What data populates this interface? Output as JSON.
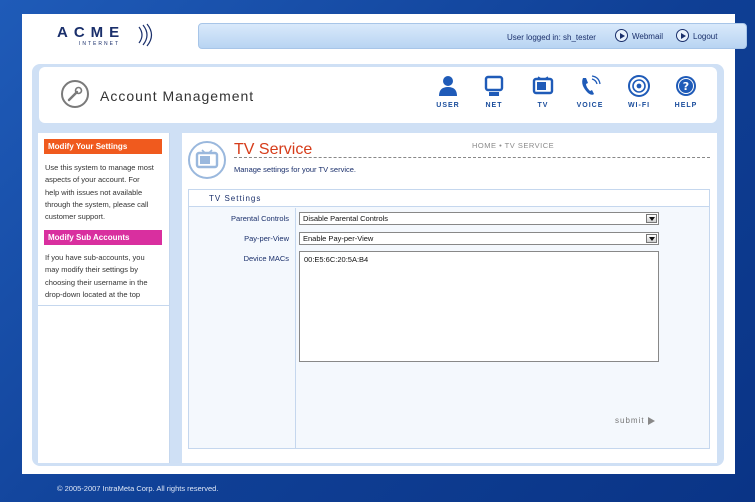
{
  "logo": {
    "main": "ACME",
    "sub": "INTERNET"
  },
  "userbar": {
    "logged_in_text": "User logged in: sh_tester",
    "webmail": "Webmail",
    "logout": "Logout"
  },
  "header": {
    "title": "Account Management",
    "nav": [
      {
        "label": "USER",
        "icon": "user-icon"
      },
      {
        "label": "NET",
        "icon": "monitor-icon"
      },
      {
        "label": "TV",
        "icon": "tv-icon"
      },
      {
        "label": "VOICE",
        "icon": "phone-icon"
      },
      {
        "label": "WI-FI",
        "icon": "wifi-icon"
      },
      {
        "label": "HELP",
        "icon": "help-icon"
      }
    ]
  },
  "sidebar": {
    "modify_settings": {
      "heading": "Modify Your Settings",
      "color": "#f05a1e",
      "lines": [
        "Use this system to manage most",
        "aspects of your account.  For",
        "help with issues not available",
        "through the system, please call",
        "customer support."
      ]
    },
    "modify_sub": {
      "heading": "Modify Sub Accounts",
      "color": "#d92f9f",
      "lines": [
        "If you have sub-accounts, you",
        "may modify their settings by",
        "choosing their username in the",
        "drop-down located at the top"
      ]
    }
  },
  "page": {
    "title": "TV Service",
    "subtitle": "Manage settings for your TV service.",
    "breadcrumb": "HOME • TV SERVICE"
  },
  "settings": {
    "heading": "TV Settings",
    "parental_label": "Parental Controls",
    "parental_value": "Disable Parental Controls",
    "ppv_label": "Pay-per-View",
    "ppv_value": "Enable Pay-per-View",
    "macs_label": "Device MACs",
    "macs_value": "00:E5:6C:20:5A:B4",
    "submit": "submit"
  },
  "footer": "© 2005-2007 IntraMeta Corp. All rights reserved."
}
